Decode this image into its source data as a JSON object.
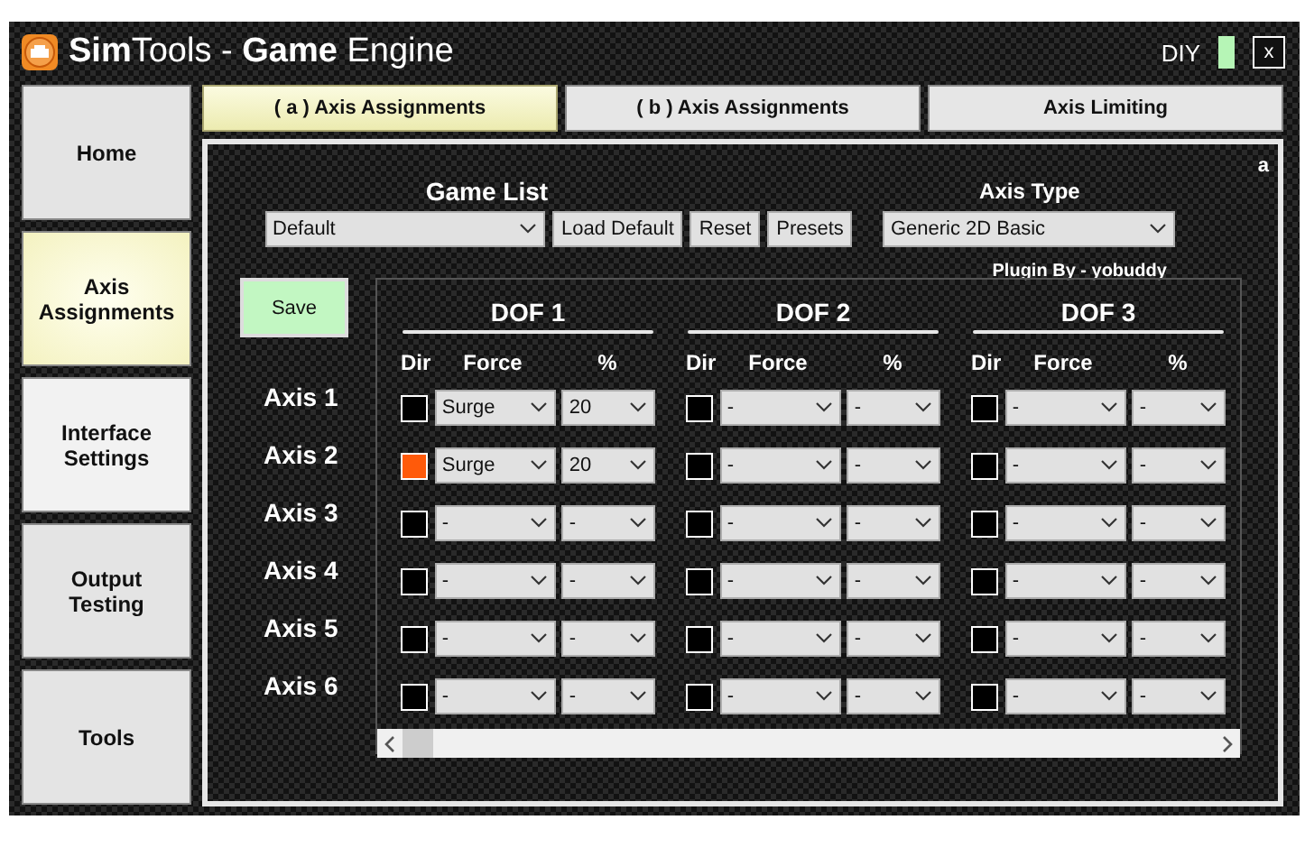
{
  "window": {
    "title": "**Sim**Tools - **Game** Engine",
    "mode": "DIY",
    "close": "x"
  },
  "sidebar": {
    "items": [
      {
        "label": "Home",
        "selected": false,
        "hover": false
      },
      {
        "label": "Axis Assignments",
        "selected": true,
        "hover": false
      },
      {
        "label": "Interface Settings",
        "selected": false,
        "hover": true
      },
      {
        "label": "Output Testing",
        "selected": false,
        "hover": false
      },
      {
        "label": "Tools",
        "selected": false,
        "hover": false
      }
    ]
  },
  "tabs": [
    {
      "label": "( a ) Axis Assignments",
      "selected": true
    },
    {
      "label": "( b ) Axis Assignments",
      "selected": false
    },
    {
      "label": "Axis Limiting",
      "selected": false
    }
  ],
  "panel": {
    "corner_label": "a",
    "game_list": {
      "label": "Game List",
      "value": "Default"
    },
    "buttons": [
      "Load Default",
      "Reset",
      "Presets"
    ],
    "axis_type": {
      "label": "Axis Type",
      "value": "Generic 2D Basic"
    },
    "plugin_credit": "Plugin By - yobuddy",
    "save": "Save",
    "dofs": [
      {
        "title": "DOF 1",
        "headers": [
          "Dir",
          "Force",
          "%"
        ]
      },
      {
        "title": "DOF 2",
        "headers": [
          "Dir",
          "Force",
          "%"
        ]
      },
      {
        "title": "DOF 3",
        "headers": [
          "Dir",
          "Force",
          "%"
        ]
      }
    ],
    "axes": [
      {
        "label": "Axis 1",
        "cells": [
          {
            "dir": false,
            "force": "Surge",
            "percent": "20"
          },
          {
            "dir": false,
            "force": "-",
            "percent": "-"
          },
          {
            "dir": false,
            "force": "-",
            "percent": "-"
          }
        ]
      },
      {
        "label": "Axis 2",
        "cells": [
          {
            "dir": true,
            "force": "Surge",
            "percent": "20"
          },
          {
            "dir": false,
            "force": "-",
            "percent": "-"
          },
          {
            "dir": false,
            "force": "-",
            "percent": "-"
          }
        ]
      },
      {
        "label": "Axis 3",
        "cells": [
          {
            "dir": false,
            "force": "-",
            "percent": "-"
          },
          {
            "dir": false,
            "force": "-",
            "percent": "-"
          },
          {
            "dir": false,
            "force": "-",
            "percent": "-"
          }
        ]
      },
      {
        "label": "Axis 4",
        "cells": [
          {
            "dir": false,
            "force": "-",
            "percent": "-"
          },
          {
            "dir": false,
            "force": "-",
            "percent": "-"
          },
          {
            "dir": false,
            "force": "-",
            "percent": "-"
          }
        ]
      },
      {
        "label": "Axis 5",
        "cells": [
          {
            "dir": false,
            "force": "-",
            "percent": "-"
          },
          {
            "dir": false,
            "force": "-",
            "percent": "-"
          },
          {
            "dir": false,
            "force": "-",
            "percent": "-"
          }
        ]
      },
      {
        "label": "Axis 6",
        "cells": [
          {
            "dir": false,
            "force": "-",
            "percent": "-"
          },
          {
            "dir": false,
            "force": "-",
            "percent": "-"
          },
          {
            "dir": false,
            "force": "-",
            "percent": "-"
          }
        ]
      }
    ]
  }
}
